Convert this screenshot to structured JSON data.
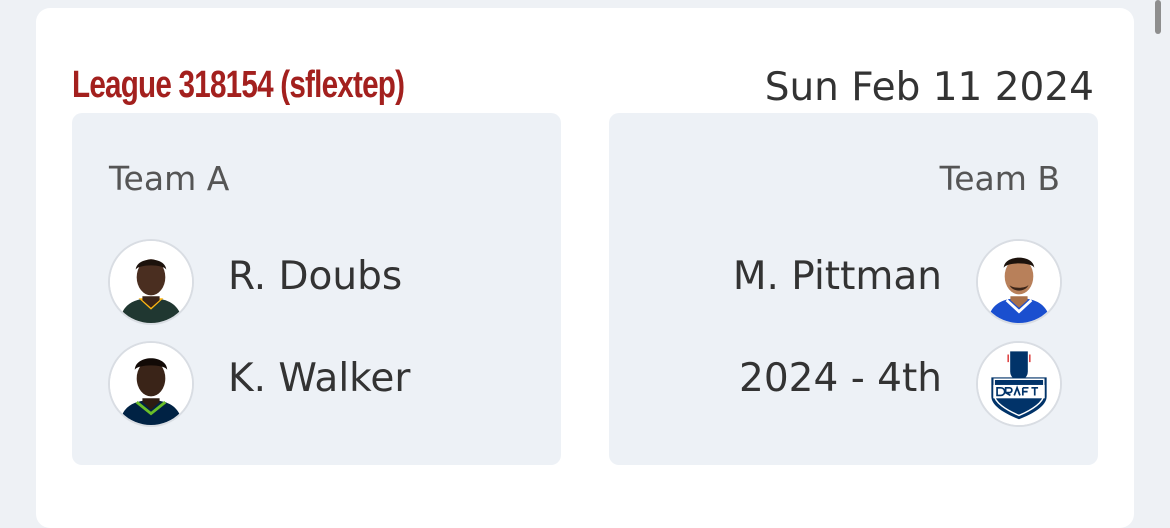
{
  "header": {
    "league_title": "League 318154 (sflextep)",
    "date": "Sun Feb 11 2024"
  },
  "team_a": {
    "name": "Team A",
    "assets": [
      {
        "label": "R. Doubs",
        "icon": "player-headshot-icon"
      },
      {
        "label": "K. Walker",
        "icon": "player-headshot-icon"
      }
    ]
  },
  "team_b": {
    "name": "Team B",
    "assets": [
      {
        "label": "M. Pittman",
        "icon": "player-headshot-icon"
      },
      {
        "label": "2024 - 4th",
        "icon": "nfl-draft-icon"
      }
    ]
  },
  "colors": {
    "league_title": "#a3201e",
    "card_background": "#ffffff",
    "team_box_background": "#edf1f6",
    "page_background": "#eef1f5"
  }
}
